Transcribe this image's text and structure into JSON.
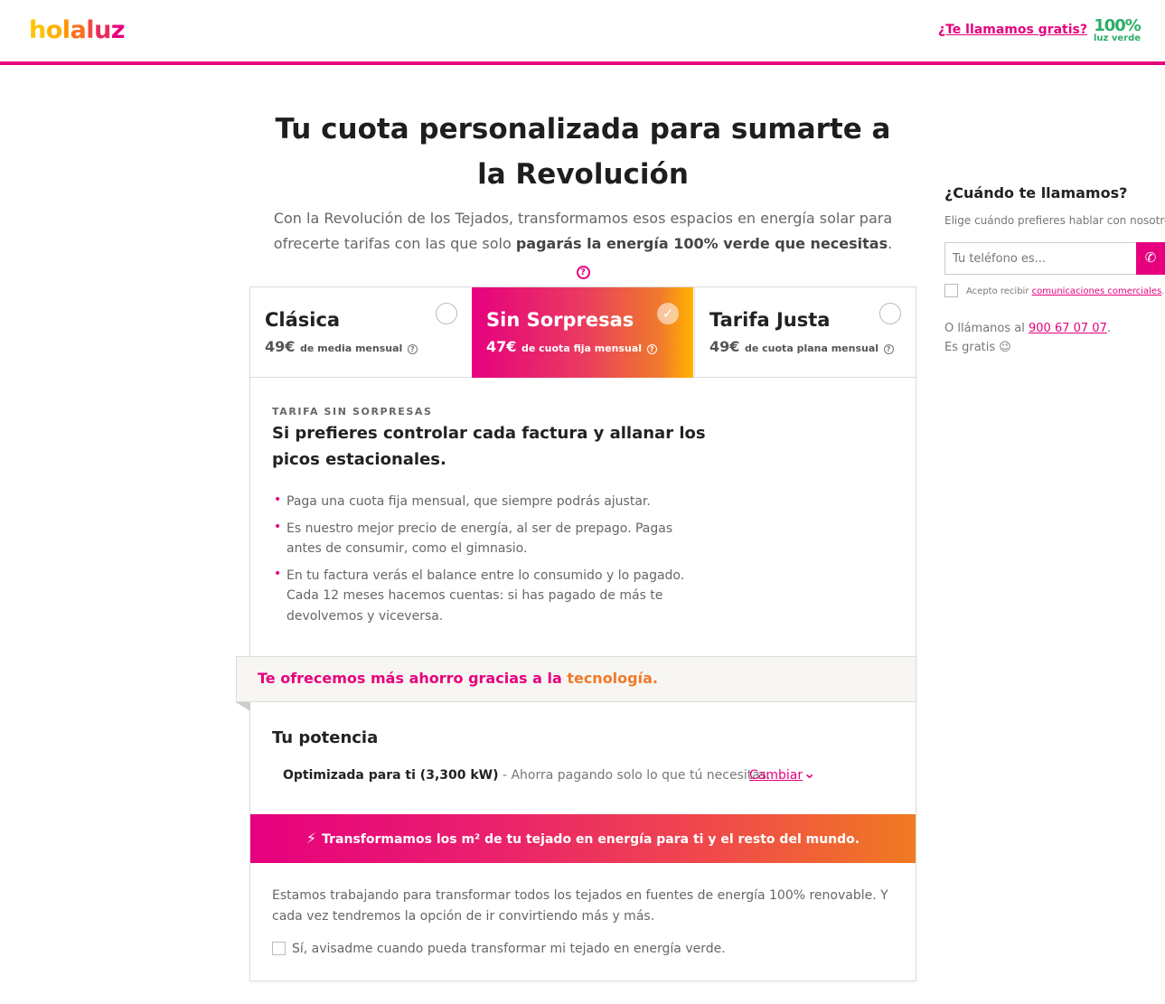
{
  "header": {
    "logo_text": "holaluz",
    "call_link": "¿Te llamamos gratis?",
    "green_badge_pct": "100%",
    "green_badge_text": "luz verde"
  },
  "hero": {
    "title": "Tu cuota personalizada para sumarte a la Revolución",
    "subtitle_prefix": "Con la Revolución de los Tejados, transformamos esos espacios en energía solar para ofrecerte tarifas con las que solo ",
    "subtitle_bold": "pagarás la energía 100% verde que necesitas",
    "subtitle_suffix": "."
  },
  "tariffs": [
    {
      "name": "Clásica",
      "price": "49€",
      "price_desc": "de media mensual",
      "selected": false
    },
    {
      "name": "Sin Sorpresas",
      "price": "47€",
      "price_desc": "de cuota fija mensual",
      "selected": true
    },
    {
      "name": "Tarifa Justa",
      "price": "49€",
      "price_desc": "de cuota plana mensual",
      "selected": false
    }
  ],
  "details": {
    "label": "TARIFA SIN SORPRESAS",
    "headline": "Si prefieres controlar cada factura y allanar los picos estacionales.",
    "bullets": [
      "Paga una cuota fija mensual, que siempre podrás ajustar.",
      "Es nuestro mejor precio de energía, al ser de prepago. Pagas antes de consumir, como el gimnasio.",
      "En tu factura verás el balance entre lo consumido y lo pagado. Cada 12 meses hacemos cuentas: si has pagado de más te devolvemos y viceversa."
    ]
  },
  "ahorro": {
    "text_pink": "Te ofrecemos más ahorro gracias a la ",
    "text_orange": "tecnología."
  },
  "potencia": {
    "title": "Tu potencia",
    "value_bold": "Optimizada para ti (3,300 kW)",
    "value_desc": " - Ahorra pagando solo lo que tú necesitas.",
    "change_label": "Cambiar"
  },
  "banner": {
    "text": "Transformamos los m² de tu tejado en energía para ti y el resto del mundo."
  },
  "tejados": {
    "text": "Estamos trabajando para transformar todos los tejados en fuentes de energía 100% renovable. Y cada vez tendremos la opción de ir convirtiendo más y más.",
    "checkbox_label": "Sí, avisadme cuando pueda transformar mi tejado en energía verde."
  },
  "sidebar": {
    "title": "¿Cuándo te llamamos?",
    "subtitle": "Elige cuándo prefieres hablar con nosotros.",
    "phone_placeholder": "Tu teléfono es...",
    "accept_prefix": "Acepto recibir ",
    "accept_link": "comunicaciones comerciales",
    "accept_suffix": ".",
    "call_prefix": "O llámanos al ",
    "call_number": "900 67 07 07",
    "call_suffix": ". Es gratis 😉"
  },
  "colors": {
    "brand_pink": "#e6007e",
    "brand_orange": "#f07a2c",
    "green": "#2bae66"
  }
}
